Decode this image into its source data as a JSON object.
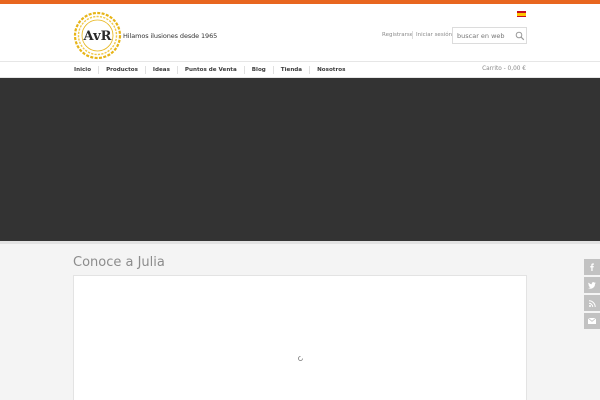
{
  "brand": {
    "logo_text": "AvR",
    "tagline": "Hilamos ilusiones desde 1965"
  },
  "colors": {
    "accent": "#e8661f",
    "banner": "#333333",
    "logo_gold": "#e7b416"
  },
  "language": {
    "flag": "spain-flag-icon"
  },
  "account": {
    "register_label": "Registrarse",
    "login_label": "Iniciar sesión"
  },
  "search": {
    "placeholder": "buscar en web",
    "icon": "search-icon"
  },
  "nav": {
    "items": [
      {
        "label": "Inicio"
      },
      {
        "label": "Productos"
      },
      {
        "label": "Ideas"
      },
      {
        "label": "Puntos de Venta"
      },
      {
        "label": "Blog"
      },
      {
        "label": "Tienda"
      },
      {
        "label": "Nosotros"
      }
    ],
    "cart_label": "Carrito - 0,00 €"
  },
  "main": {
    "title": "Conoce a Julia"
  },
  "social": [
    {
      "icon": "facebook-icon"
    },
    {
      "icon": "twitter-icon"
    },
    {
      "icon": "rss-icon"
    },
    {
      "icon": "email-icon"
    }
  ]
}
